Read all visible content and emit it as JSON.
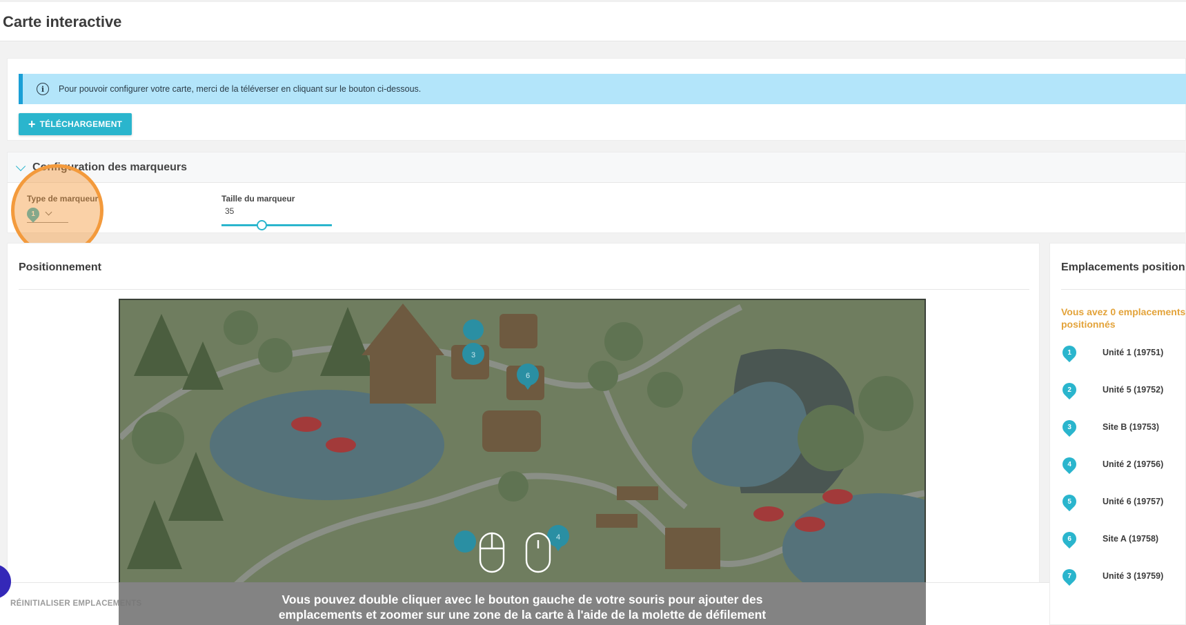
{
  "page": {
    "title": "Carte interactive"
  },
  "upload": {
    "info_text": "Pour pouvoir configurer votre carte, merci de la téléverser en cliquant sur le bouton ci-dessous.",
    "button_label": "TÉLÉCHARGEMENT"
  },
  "markers": {
    "section_title": "Configuration des marqueurs",
    "type_label": "Type de marqueur",
    "type_value": "1",
    "size_label": "Taille du marqueur",
    "size_value": "35",
    "size_slider_fraction": 0.35
  },
  "positioning": {
    "title": "Positionnement",
    "hint_line1": "Vous pouvez double cliquer avec le bouton gauche de votre souris pour ajouter des",
    "hint_line2": "emplacements et zoomer sur une zone de la carte à l'aide de la molette de défilement",
    "map_pins": [
      "3",
      "6",
      "4"
    ]
  },
  "locations": {
    "title": "Emplacements positionés",
    "empty_message": "Vous avez 0 emplacements positionnés",
    "items": [
      {
        "number": "1",
        "label": "Unité 1 (19751)"
      },
      {
        "number": "2",
        "label": "Unité 5 (19752)"
      },
      {
        "number": "3",
        "label": "Site B (19753)"
      },
      {
        "number": "4",
        "label": "Unité 2 (19756)"
      },
      {
        "number": "5",
        "label": "Unité 6 (19757)"
      },
      {
        "number": "6",
        "label": "Site A (19758)"
      },
      {
        "number": "7",
        "label": "Unité 3 (19759)"
      }
    ]
  },
  "footer": {
    "reset_label": "RÉINITIALISER EMPLACEMENTS"
  },
  "colors": {
    "accent": "#2ab5cd",
    "info_bg": "#b3e5fa",
    "warning": "#e3a33a",
    "highlight": "#f39a3c"
  }
}
